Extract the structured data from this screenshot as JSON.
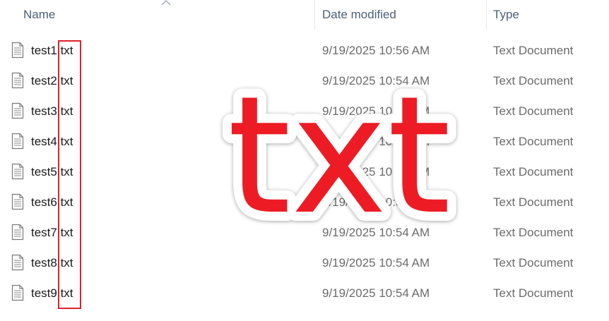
{
  "header": {
    "name_label": "Name",
    "date_label": "Date modified",
    "type_label": "Type",
    "sort": "ascending"
  },
  "files": [
    {
      "name": "test1.txt",
      "date": "9/19/2025 10:56 AM",
      "type": "Text Document"
    },
    {
      "name": "test2.txt",
      "date": "9/19/2025 10:54 AM",
      "type": "Text Document"
    },
    {
      "name": "test3.txt",
      "date": "9/19/2025 10:54 AM",
      "type": "Text Document"
    },
    {
      "name": "test4.txt",
      "date": "9/19/2025 10:54 AM",
      "type": "Text Document"
    },
    {
      "name": "test5.txt",
      "date": "9/19/2025 10:54 AM",
      "type": "Text Document"
    },
    {
      "name": "test6.txt",
      "date": "9/19/2025 10:54 AM",
      "type": "Text Document"
    },
    {
      "name": "test7.txt",
      "date": "9/19/2025 10:54 AM",
      "type": "Text Document"
    },
    {
      "name": "test8.txt",
      "date": "9/19/2025 10:54 AM",
      "type": "Text Document"
    },
    {
      "name": "test9.txt",
      "date": "9/19/2025 10:54 AM",
      "type": "Text Document"
    }
  ],
  "overlay": {
    "text": "txt",
    "color": "#ed1c24"
  },
  "icons": {
    "file": "text-document-icon",
    "sort": "chevron-up-icon"
  },
  "colors": {
    "highlight": "#e0202a",
    "header_text": "#4a6078",
    "secondary_text": "#6b6b6b"
  }
}
